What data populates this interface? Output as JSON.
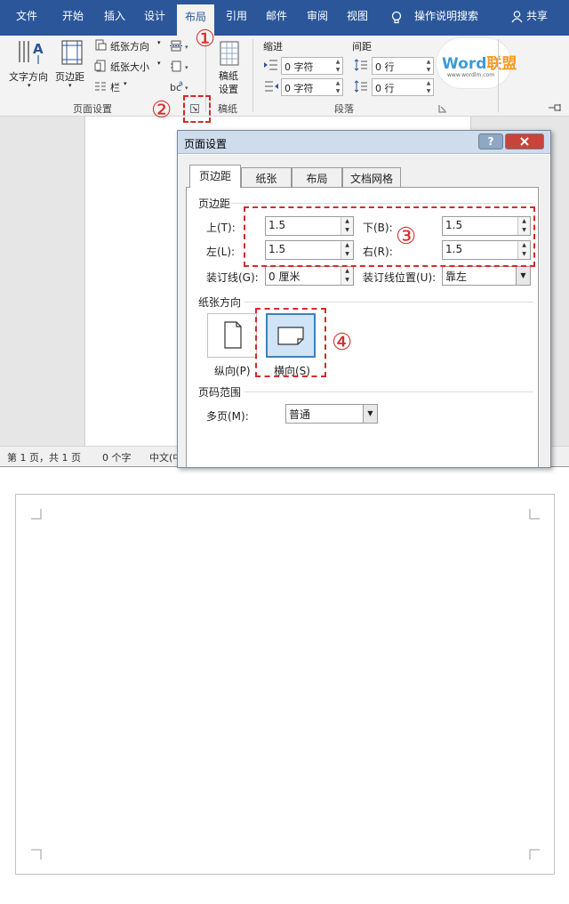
{
  "ribbon_tabs": [
    "文件",
    "开始",
    "插入",
    "设计",
    "布局",
    "引用",
    "邮件",
    "审阅",
    "视图"
  ],
  "active_tab": "布局",
  "tell_me": "操作说明搜索",
  "share": "共享",
  "ribbon": {
    "text_direction": "文字方向",
    "margins": "页边距",
    "orientation": "纸张方向",
    "paper_size": "纸张大小",
    "columns": "栏",
    "manuscript": "稿纸设置",
    "manuscript_line1": "稿纸",
    "manuscript_line2": "设置",
    "page_setup_group": "页面设置",
    "manuscript_group": "稿纸",
    "paragraph_group": "段落",
    "indent_label": "缩进",
    "spacing_label": "间距",
    "indent_left": "0 字符",
    "indent_right": "0 字符",
    "spacing_before": "0 行",
    "spacing_after": "0 行"
  },
  "logo": {
    "word": "Word",
    "lianmeng": "联盟",
    "url": "www.wordlm.com"
  },
  "status": {
    "page": "第 1 页，共 1 页",
    "words": "0 个字",
    "lang": "中文(中"
  },
  "dialog": {
    "title": "页面设置",
    "help": "?",
    "tabs": [
      "页边距",
      "纸张",
      "布局",
      "文档网格"
    ],
    "margins_section": "页边距",
    "top_label": "上(T):",
    "top_value": "1.5",
    "bottom_label": "下(B):",
    "bottom_value": "1.5",
    "left_label": "左(L):",
    "left_value": "1.5",
    "right_label": "右(R):",
    "right_value": "1.5",
    "gutter_label": "装订线(G):",
    "gutter_value": "0 厘米",
    "gutter_pos_label": "装订线位置(U):",
    "gutter_pos_value": "靠左",
    "orientation_section": "纸张方向",
    "portrait": "纵向(P)",
    "landscape": "横向(S)",
    "pages_section": "页码范围",
    "multiple_label": "多页(M):",
    "multiple_value": "普通"
  },
  "annotations": [
    "①",
    "②",
    "③",
    "④"
  ],
  "colors": {
    "accent": "#2b579a",
    "annotation": "#d42a2a",
    "selected": "#3c7fc1"
  }
}
